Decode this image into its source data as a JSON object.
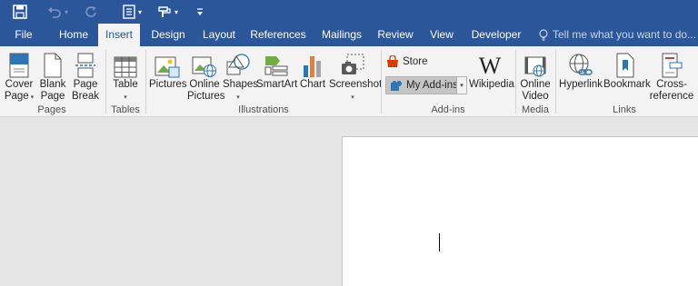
{
  "tabs": {
    "file": "File",
    "home": "Home",
    "insert": "Insert",
    "design": "Design",
    "layout": "Layout",
    "references": "References",
    "mailings": "Mailings",
    "review": "Review",
    "view": "View",
    "developer": "Developer",
    "tell_me": "Tell me what you want to do..."
  },
  "pages": {
    "cover_page": "Cover Page",
    "cover_line1": "Cover",
    "cover_line2": "Page",
    "blank_line1": "Blank",
    "blank_line2": "Page",
    "break_line1": "Page",
    "break_line2": "Break",
    "group": "Pages"
  },
  "tables": {
    "table": "Table",
    "group": "Tables"
  },
  "illustrations": {
    "pictures": "Pictures",
    "online_line1": "Online",
    "online_line2": "Pictures",
    "shapes": "Shapes",
    "smartart": "SmartArt",
    "chart": "Chart",
    "screenshot": "Screenshot",
    "group": "Illustrations"
  },
  "addins": {
    "store": "Store",
    "my_addins": "My Add-ins",
    "wikipedia": "Wikipedia",
    "group": "Add-ins"
  },
  "media": {
    "line1": "Online",
    "line2": "Video",
    "group": "Media"
  },
  "links": {
    "hyperlink": "Hyperlink",
    "bookmark": "Bookmark",
    "cross_line1": "Cross-",
    "cross_line2": "reference",
    "group": "Links"
  },
  "colors": {
    "brand": "#2b579a",
    "ribbon_bg": "#f3f3f3",
    "doc_bg": "#e6e6e6"
  }
}
